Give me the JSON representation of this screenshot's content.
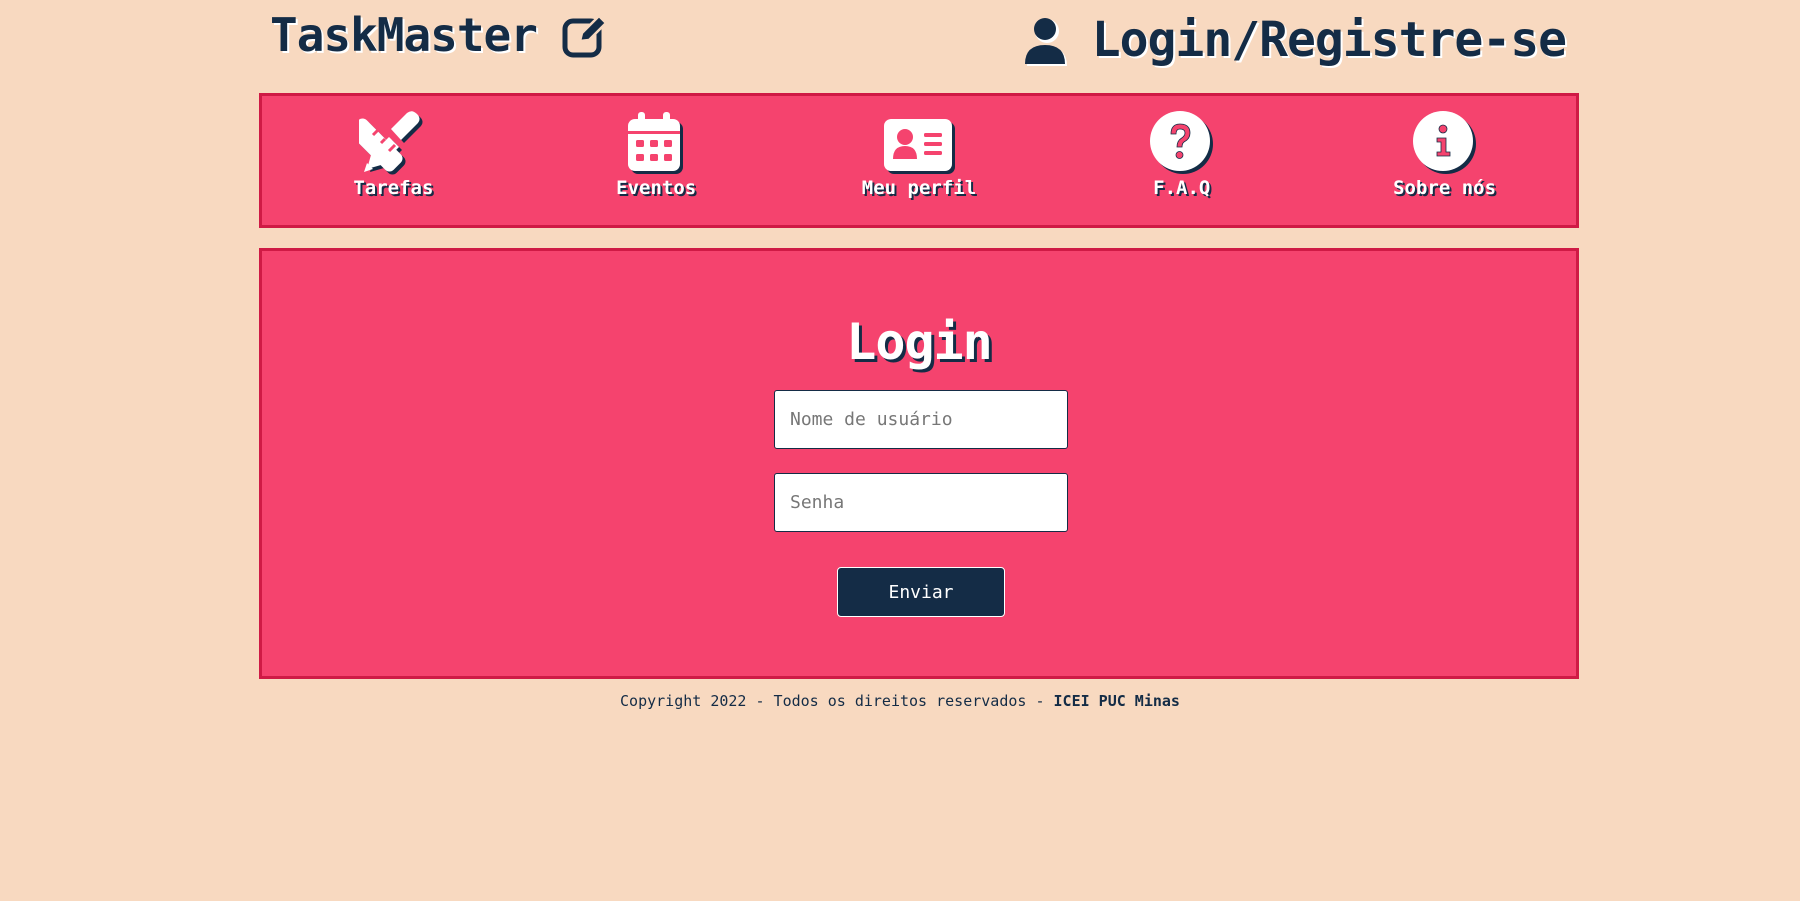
{
  "header": {
    "brand_title": "TaskMaster",
    "brand_icon": "pen-to-square-icon",
    "login_link_label": "Login/Registre-se",
    "login_link_icon": "user-icon"
  },
  "nav": {
    "items": [
      {
        "label": "Tarefas",
        "icon": "pencil-ruler-icon"
      },
      {
        "label": "Eventos",
        "icon": "calendar-icon"
      },
      {
        "label": "Meu perfil",
        "icon": "id-card-icon"
      },
      {
        "label": "F.A.Q",
        "icon": "question-circle-icon"
      },
      {
        "label": "Sobre nós",
        "icon": "info-circle-icon"
      }
    ]
  },
  "login_form": {
    "title": "Login",
    "username_placeholder": "Nome de usuário",
    "username_value": "",
    "password_placeholder": "Senha",
    "password_value": "",
    "submit_label": "Enviar"
  },
  "footer": {
    "copyright_text": "Copyright 2022 - Todos os direitos reservados - ",
    "organization": "ICEI PUC Minas"
  },
  "colors": {
    "page_background": "#f8d9c0",
    "panel_background": "#f5436e",
    "panel_border": "#cf1a45",
    "navy": "#142c46",
    "white": "#ffffff"
  }
}
